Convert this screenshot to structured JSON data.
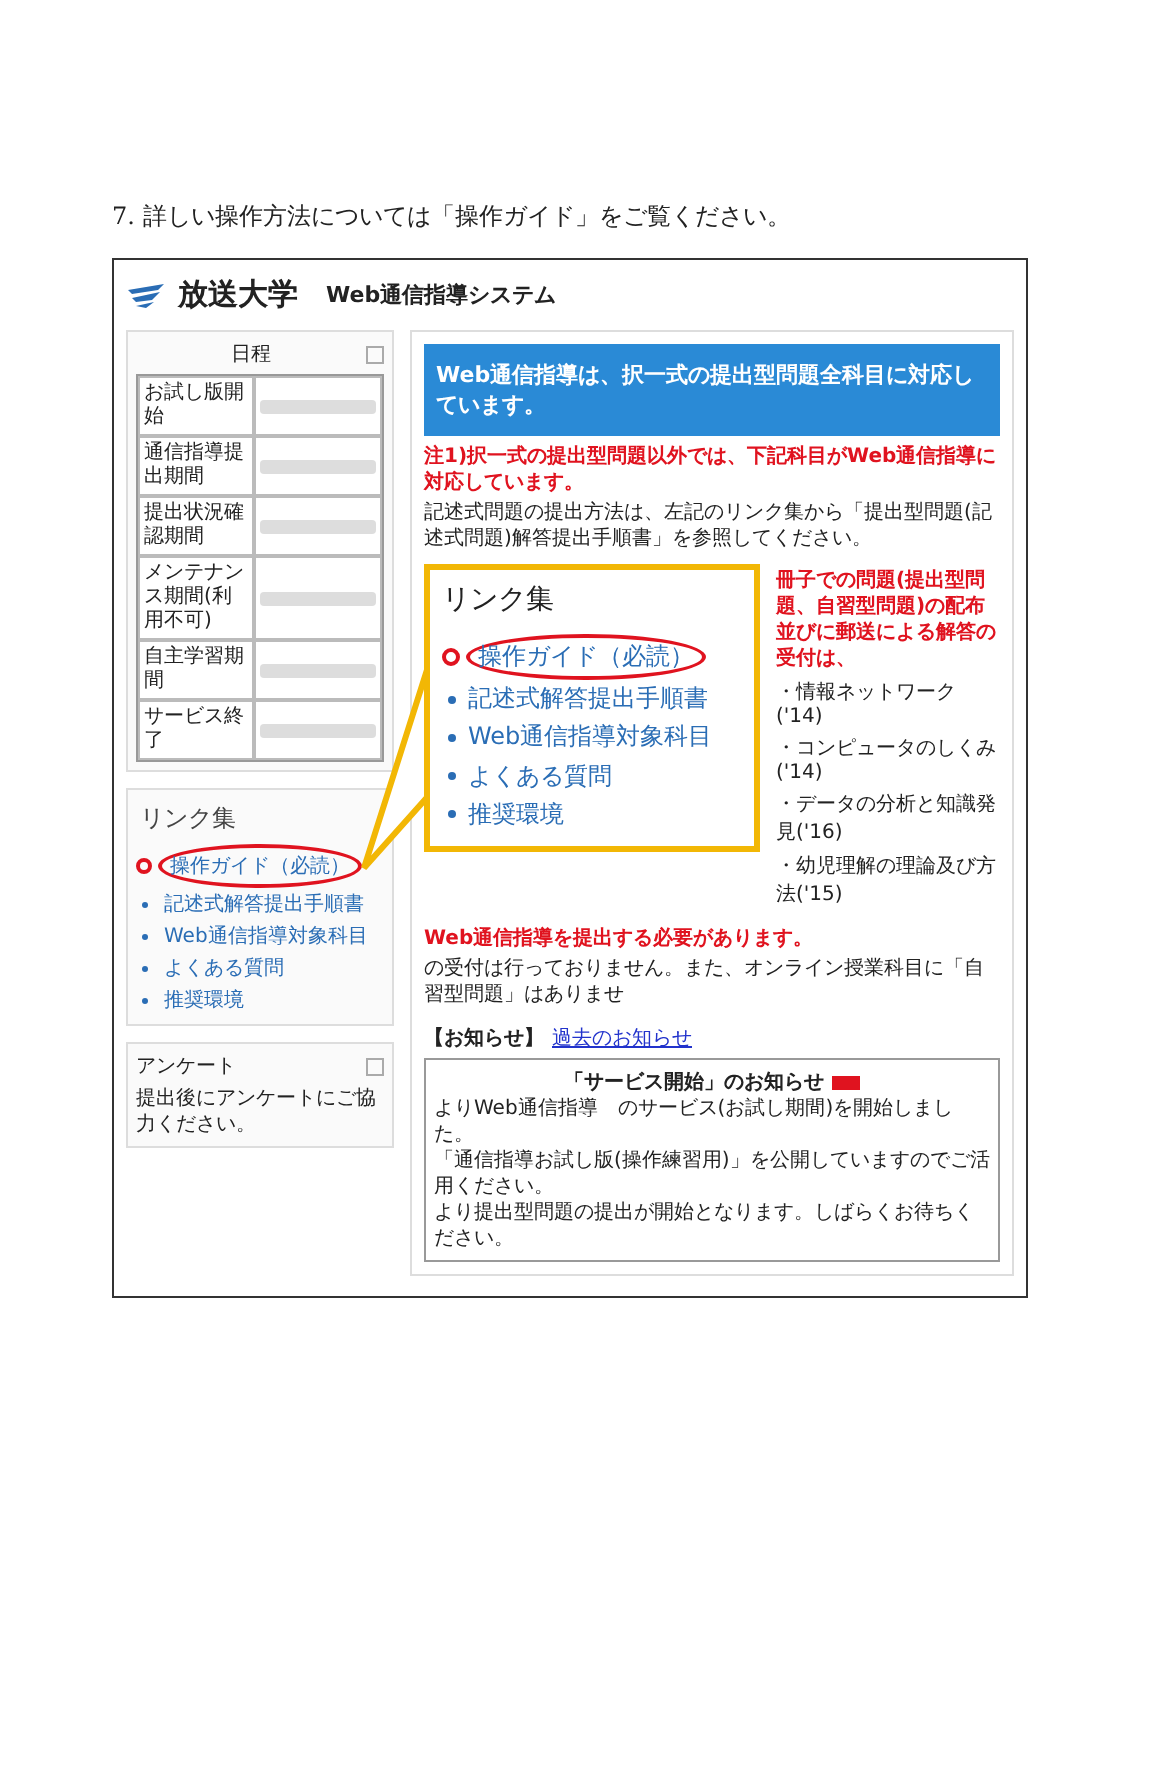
{
  "caption": "7. 詳しい操作方法については「操作ガイド」をご覧ください。",
  "header": {
    "logo": "放送大学",
    "system_title": "Web通信指導システム"
  },
  "schedule": {
    "title": "日程",
    "rows": [
      {
        "label": "お試し版開始"
      },
      {
        "label": "通信指導提出期間"
      },
      {
        "label": "提出状況確認期間"
      },
      {
        "label": "メンテナンス期間(利用不可)"
      },
      {
        "label": "自主学習期間"
      },
      {
        "label": "サービス終了"
      }
    ]
  },
  "links": {
    "title": "リンク集",
    "items": [
      {
        "label": "操作ガイド（必読）",
        "kind": "required",
        "highlighted": true
      },
      {
        "label": "記述式解答提出手順書",
        "kind": "normal",
        "highlighted": false
      },
      {
        "label": "Web通信指導対象科目",
        "kind": "normal",
        "highlighted": false
      },
      {
        "label": "よくある質問",
        "kind": "normal",
        "highlighted": false
      },
      {
        "label": "推奨環境",
        "kind": "normal",
        "highlighted": false
      }
    ]
  },
  "survey": {
    "title": "アンケート",
    "text": "提出後にアンケートにご協力ください。"
  },
  "banner": "Web通信指導は、択一式の提出型問題全科目に対応しています。",
  "notes_top": [
    {
      "text": "注1)択一式の提出型問題以外では、下記科目がWeb通信指導に対応しています。",
      "kind": "alert"
    },
    {
      "text": "記述式問題の提出方法は、左記のリンク集から「提出型問題(記述式問題)解答提出手順書」を参照してください。",
      "kind": "plain"
    }
  ],
  "notes_side": [
    {
      "text": "冊子での問題(提出型問題、自習型問題)の配布並びに郵送による解答の受付は、",
      "kind": "alert"
    }
  ],
  "subjects": [
    "・情報ネットワーク('14)",
    "・コンピュータのしくみ('14)",
    "・データの分析と知識発見('16)",
    "・幼児理解の理論及び方法('15)"
  ],
  "notes_bottom": [
    {
      "text": "Web通信指導を提出する必要があります。",
      "kind": "alert"
    },
    {
      "text": "の受付は行っておりません。また、オンライン授業科目に「自習型問題」はありませ",
      "kind": "plain"
    }
  ],
  "callout": {
    "title": "リンク集",
    "items": [
      {
        "label": "操作ガイド（必読）",
        "kind": "required",
        "highlighted": true
      },
      {
        "label": "記述式解答提出手順書",
        "kind": "normal",
        "highlighted": false
      },
      {
        "label": "Web通信指導対象科目",
        "kind": "normal",
        "highlighted": false
      },
      {
        "label": "よくある質問",
        "kind": "normal",
        "highlighted": false
      },
      {
        "label": "推奨環境",
        "kind": "normal",
        "highlighted": false
      }
    ]
  },
  "notices": {
    "label": "【お知らせ】",
    "past_link": "過去のお知らせ",
    "box_title": "「サービス開始」のお知らせ",
    "new": true,
    "lines": [
      "よりWeb通信指導　のサービス(お試し期間)を開始しました。",
      "「通信指導お試し版(操作練習用)」を公開していますのでご活用ください。",
      "より提出型問題の提出が開始となります。しばらくお待ちください。"
    ]
  }
}
